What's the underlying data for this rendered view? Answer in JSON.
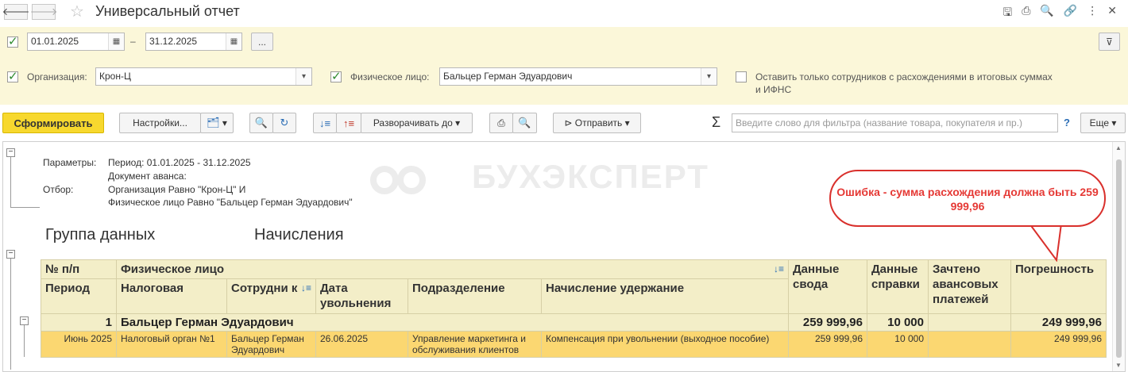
{
  "window": {
    "title": "Универсальный отчет"
  },
  "params": {
    "date_from": "01.01.2025",
    "date_sep": "–",
    "date_to": "31.12.2025",
    "more_btn": "...",
    "org_label": "Организация:",
    "org_value": "Крон-Ц",
    "person_label": "Физическое лицо:",
    "person_value": "Бальцер Герман Эдуардович",
    "only_diff_label": "Оставить только сотрудников с расхождениями в итоговых суммах и ИФНС"
  },
  "toolbar": {
    "generate": "Сформировать",
    "settings": "Настройки...",
    "expand_to": "Разворачивать до",
    "send": "Отправить",
    "filter_placeholder": "Введите слово для фильтра (название товара, покупателя и пр.)",
    "help": "?",
    "more": "Еще"
  },
  "report": {
    "params_label": "Параметры:",
    "period_line": "Период: 01.01.2025 - 31.12.2025",
    "advance_line": "Документ аванса:",
    "filter_label": "Отбор:",
    "filter_line1": "Организация Равно \"Крон-Ц\" И",
    "filter_line2": "Физическое лицо Равно \"Бальцер Герман Эдуардович\"",
    "group_label": "Группа данных",
    "group_value": "Начисления",
    "watermark": "БУХЭКСПЕРТ"
  },
  "table": {
    "h_num": "№ п/п",
    "h_person": "Физическое лицо",
    "h_period": "Период",
    "h_tax": "Налоговая",
    "h_employee": "Сотрудни к",
    "h_dismiss": "Дата увольнения",
    "h_dept": "Подразделение",
    "h_accrual": "Начисление удержание",
    "h_summary": "Данные свода",
    "h_certificate": "Данные справки",
    "h_advance": "Зачтено авансовых платежей",
    "h_error": "Погрешность",
    "group_row": {
      "num": "1",
      "name": "Бальцер Герман Эдуардович",
      "summary": "259 999,96",
      "certificate": "10 000",
      "error": "249 999,96"
    },
    "detail_row": {
      "period": "Июнь 2025",
      "tax": "Налоговый орган №1",
      "employee": "Бальцер Герман Эдуардович",
      "dismiss": "26.06.2025",
      "dept": "Управление маркетинга и обслуживания клиентов",
      "accrual": "Компенсация при увольнении (выходное пособие)",
      "summary": "259 999,96",
      "certificate": "10 000",
      "advance": "",
      "error": "249 999,96"
    }
  },
  "callout": {
    "text": "Ошибка - сумма расхождения должна быть 259 999,96",
    "color": "#e53935"
  },
  "colors": {
    "panel_bg": "#fbf7d9",
    "primary_btn": "#f7d82e",
    "detail_row": "#fbd771",
    "header_bg": "#f3eec8"
  }
}
